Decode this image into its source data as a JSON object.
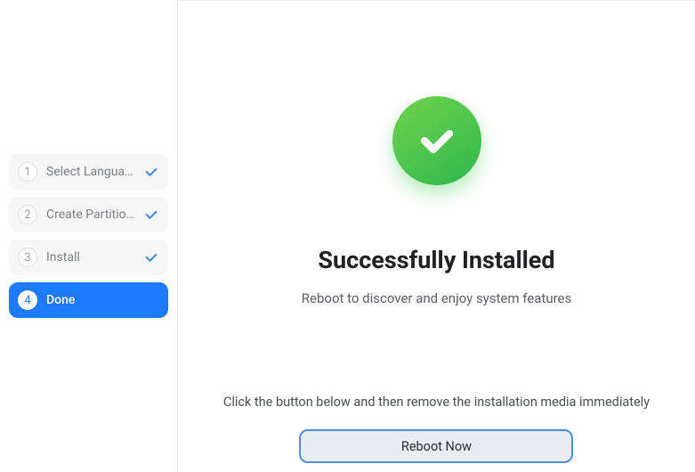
{
  "sidebar": {
    "steps": [
      {
        "num": "1",
        "label": "Select Language",
        "state": "completed"
      },
      {
        "num": "2",
        "label": "Create Partitions",
        "state": "completed"
      },
      {
        "num": "3",
        "label": "Install",
        "state": "completed"
      },
      {
        "num": "4",
        "label": "Done",
        "state": "active"
      }
    ]
  },
  "main": {
    "title": "Successfully Installed",
    "subtitle": "Reboot to discover and enjoy system features",
    "instruction": "Click the button below and then remove the installation media immediately",
    "reboot_label": "Reboot Now"
  }
}
